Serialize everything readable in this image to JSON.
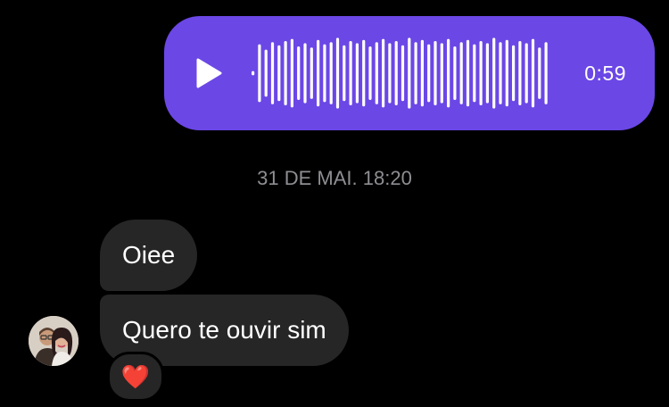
{
  "voice_message": {
    "duration": "0:59",
    "accent_color": "#6B47E6",
    "play_icon": "play-icon"
  },
  "timestamp": "31 DE MAI. 18:20",
  "messages": [
    {
      "text": "Oiee"
    },
    {
      "text": "Quero te ouvir sim"
    }
  ],
  "reaction": {
    "emoji": "❤️",
    "icon": "heart-icon"
  },
  "avatar": {
    "icon": "avatar"
  }
}
